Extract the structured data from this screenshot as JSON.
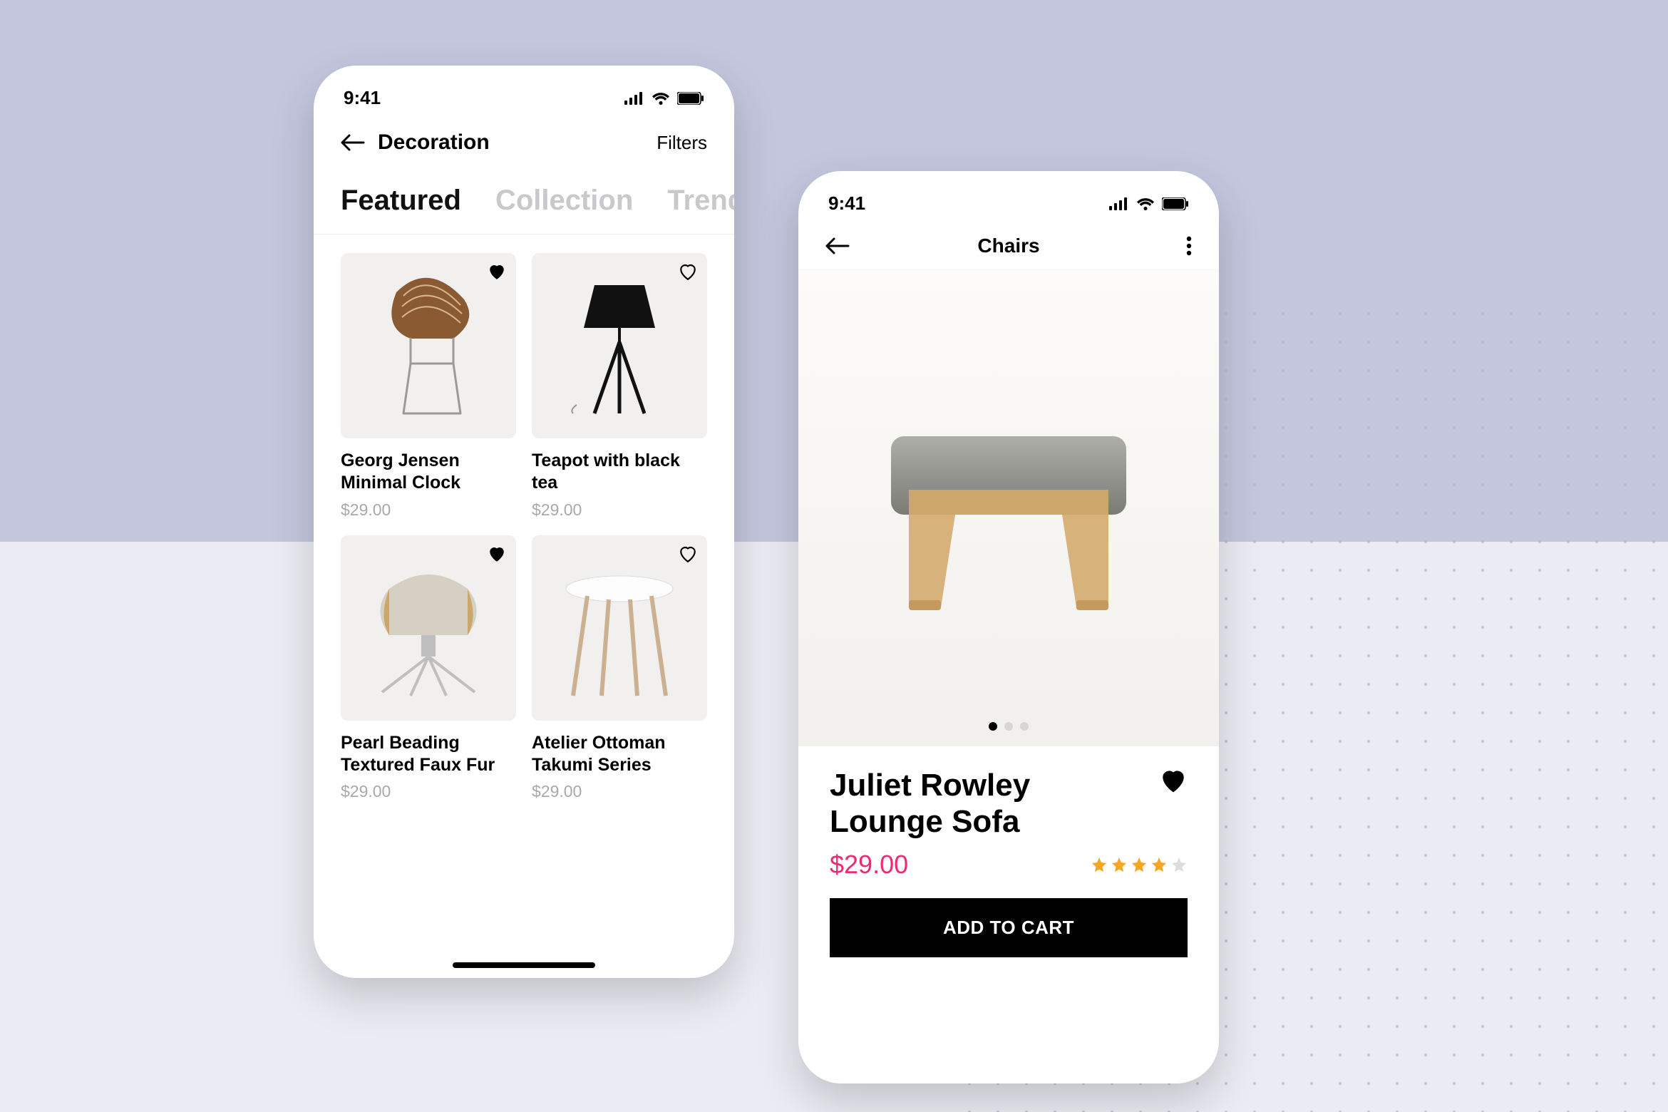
{
  "statusbar": {
    "time": "9:41"
  },
  "screenA": {
    "nav": {
      "title": "Decoration",
      "action": "Filters"
    },
    "tabs": [
      "Featured",
      "Collection",
      "Trending"
    ],
    "activeTab": 0,
    "products": [
      {
        "title": "Georg Jensen Minimal Clock",
        "price": "$29.00",
        "favorite": true
      },
      {
        "title": "Teapot with black tea",
        "price": "$29.00",
        "favorite": false
      },
      {
        "title": "Pearl Beading Textured Faux Fur",
        "price": "$29.00",
        "favorite": true
      },
      {
        "title": "Atelier Ottoman Takumi Series",
        "price": "$29.00",
        "favorite": false
      }
    ]
  },
  "screenB": {
    "nav": {
      "title": "Chairs"
    },
    "pagerCount": 3,
    "pagerActive": 0,
    "product": {
      "title": "Juliet Rowley Lounge Sofa",
      "price": "$29.00",
      "favorite": true,
      "ratingFilled": 4,
      "ratingTotal": 5
    },
    "cta": "ADD TO CART"
  }
}
